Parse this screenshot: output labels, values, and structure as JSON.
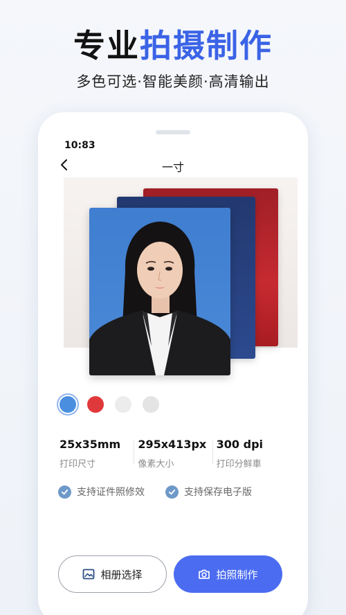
{
  "hero": {
    "title_part1": "专业",
    "title_part2": "拍摄制作",
    "subtitle": "多色可选·智能美颜·高清输出"
  },
  "status_bar": {
    "time": "10:83"
  },
  "nav": {
    "title": "一寸",
    "back_icon": "chevron-left-icon"
  },
  "preview": {
    "backgrounds": [
      "#a32026",
      "#24396f",
      "#4685d4"
    ]
  },
  "colors": {
    "accent": "#3b63e6",
    "button_primary": "#4b6cf1",
    "swatches": [
      "#4a8ee0",
      "#e0393b",
      "#ececec",
      "#e4e4e4"
    ]
  },
  "specs": [
    {
      "value": "25x35mm",
      "label": "打印尺寸"
    },
    {
      "value": "295x413px",
      "label": "像素大小"
    },
    {
      "value": "300 dpi",
      "label": "打印分鲜車"
    }
  ],
  "features": [
    {
      "label": "支持证件照修效",
      "icon": "check-circle-icon"
    },
    {
      "label": "支持保存电子版",
      "icon": "check-circle-icon"
    }
  ],
  "actions": {
    "album_label": "相册选择",
    "album_icon": "image-icon",
    "shoot_label": "拍照制作",
    "shoot_icon": "camera-icon"
  }
}
